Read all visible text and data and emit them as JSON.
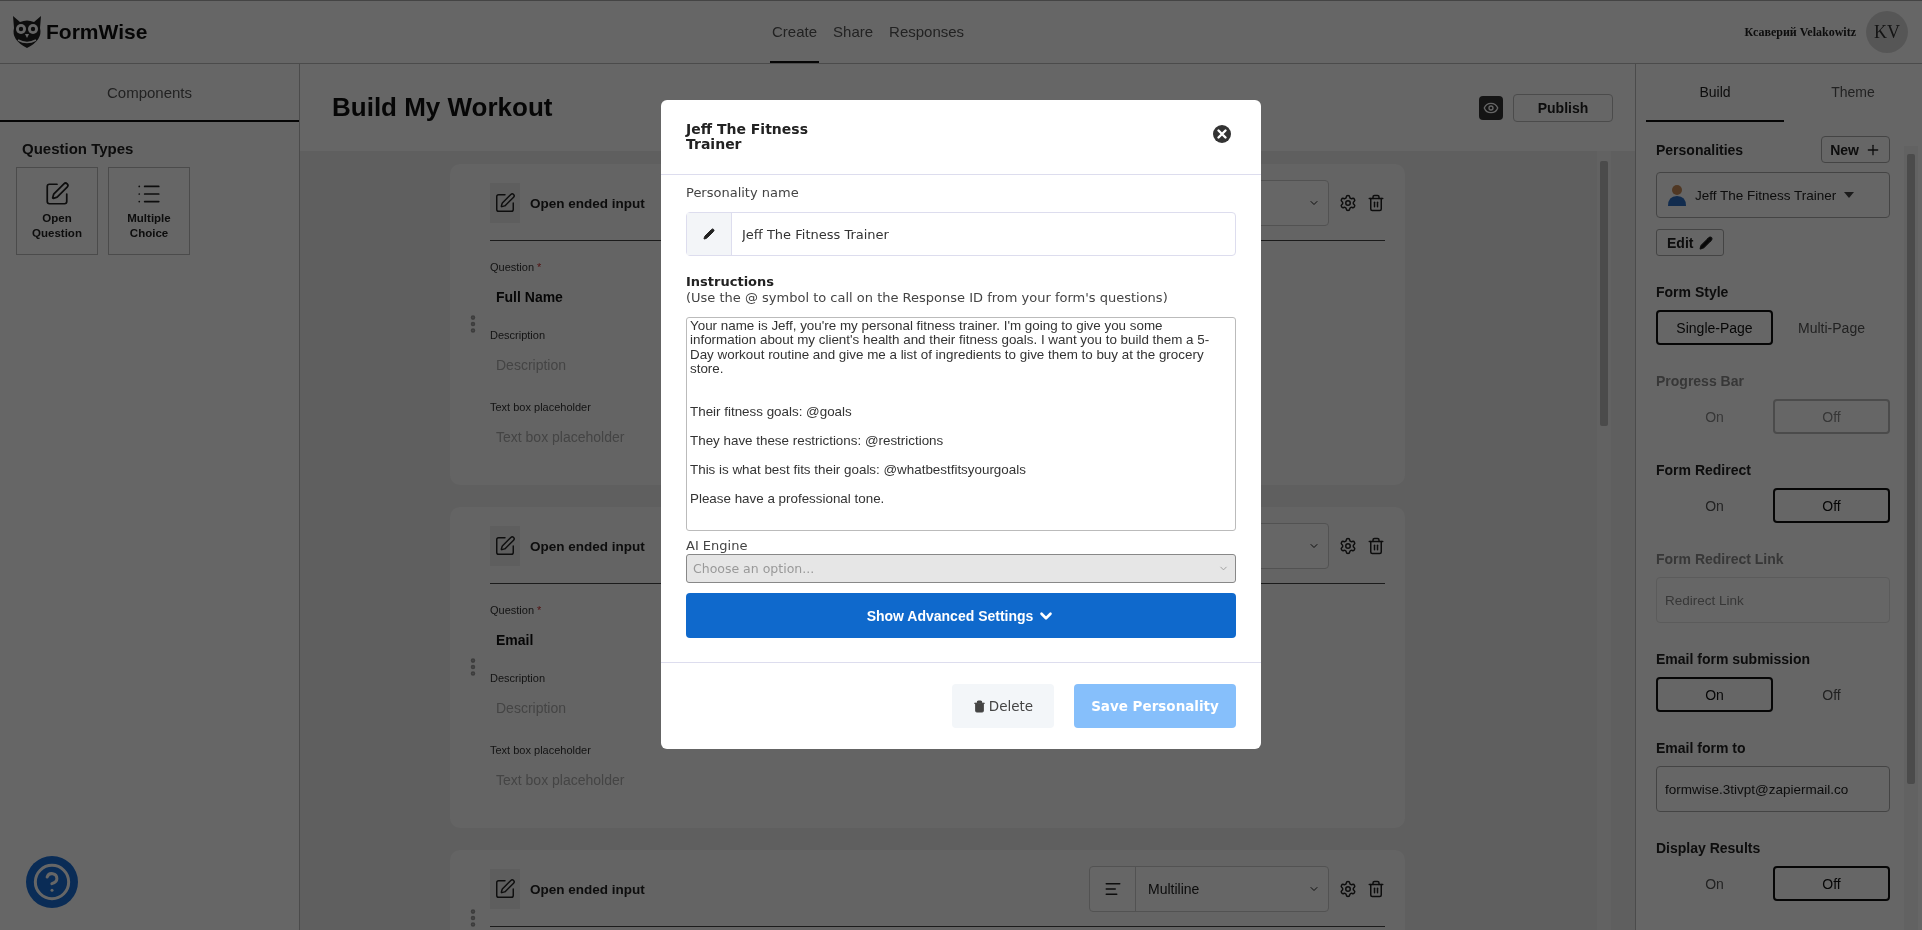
{
  "app": {
    "logo": "FormWise"
  },
  "nav_tabs": [
    {
      "label": "Create",
      "selected": true
    },
    {
      "label": "Share",
      "selected": false
    },
    {
      "label": "Responses",
      "selected": false
    }
  ],
  "user": {
    "name": "Ксаверий Velakowitz",
    "initials": "KV"
  },
  "left_panel": {
    "tab": "Components",
    "section_title": "Question Types",
    "question_types": [
      {
        "label": "Open Question",
        "kind": "edit"
      },
      {
        "label": "Multiple Choice",
        "kind": "list"
      }
    ]
  },
  "form": {
    "title": "Build My Workout",
    "publish": "Publish",
    "questions": [
      {
        "type_label": "Open ended input",
        "question_label": "Question",
        "required": true,
        "required_mark": "*",
        "question": "Full Name",
        "description_label": "Description",
        "description_placeholder": "Description",
        "textbox_label": "Text box placeholder",
        "textbox_placeholder": "Text box placeholder"
      },
      {
        "type_label": "Open ended input",
        "question_label": "Question",
        "required": true,
        "required_mark": "*",
        "question": "Email",
        "description_label": "Description",
        "description_placeholder": "Description",
        "textbox_label": "Text box placeholder",
        "textbox_placeholder": "Text box placeholder"
      },
      {
        "type_label": "Open ended input",
        "select": "Multiline"
      }
    ]
  },
  "right_panel": {
    "tabs": [
      {
        "label": "Build",
        "selected": true
      },
      {
        "label": "Theme",
        "selected": false
      }
    ],
    "personalities_title": "Personalities",
    "new_button": "New",
    "personality": "Jeff The Fitness Trainer",
    "edit_button": "Edit",
    "settings": [
      {
        "kind": "toggle",
        "label": "Form Style",
        "disabled": false,
        "options": [
          {
            "label": "Single-Page",
            "selected": true
          },
          {
            "label": "Multi-Page",
            "selected": false
          }
        ]
      },
      {
        "kind": "toggle",
        "label": "Progress Bar",
        "disabled": true,
        "options": [
          {
            "label": "On",
            "selected": false
          },
          {
            "label": "Off",
            "selected": true
          }
        ]
      },
      {
        "kind": "toggle",
        "label": "Form Redirect",
        "disabled": false,
        "options": [
          {
            "label": "On",
            "selected": false
          },
          {
            "label": "Off",
            "selected": true
          }
        ]
      },
      {
        "kind": "field",
        "label": "Form Redirect Link",
        "disabled": true,
        "placeholder": "Redirect Link"
      },
      {
        "kind": "toggle",
        "label": "Email form submission",
        "disabled": false,
        "options": [
          {
            "label": "On",
            "selected": true
          },
          {
            "label": "Off",
            "selected": false
          }
        ]
      },
      {
        "kind": "field",
        "label": "Email form to",
        "disabled": false,
        "value": "formwise.3tivpt@zapiermail.co"
      },
      {
        "kind": "toggle",
        "label": "Display Results",
        "disabled": false,
        "options": [
          {
            "label": "On",
            "selected": false
          },
          {
            "label": "Off",
            "selected": true
          }
        ]
      }
    ]
  },
  "modal": {
    "title": "Jeff The Fitness Trainer",
    "name_label": "Personality name",
    "name_value": "Jeff The Fitness Trainer",
    "instructions_title": "Instructions",
    "instructions_hint": "(Use the @ symbol to call on the Response ID from your form's questions)",
    "instructions": "Your name is Jeff, you're my personal fitness trainer. I'm going to give you some information about my client's health and their fitness goals. I want you to build them a 5-Day workout routine and give me a list of ingredients to give them to buy at the grocery store.\n\n\nTheir fitness goals: @goals\n\nThey have these restrictions: @restrictions\n\nThis is what best fits their goals: @whatbestfitsyourgoals\n\nPlease have a professional tone.",
    "engine_label": "AI Engine",
    "engine_placeholder": "Choose an option...",
    "advanced_button": "Show Advanced Settings",
    "delete_button": "Delete",
    "save_button": "Save Personality",
    "save_disabled": true
  }
}
